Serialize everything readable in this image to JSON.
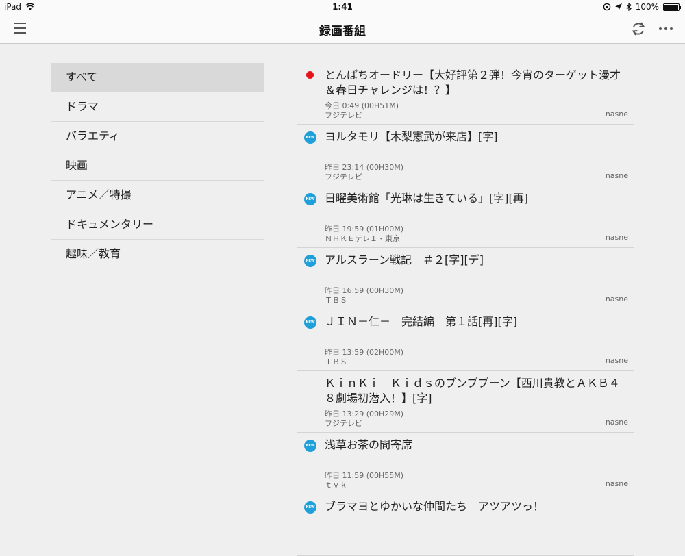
{
  "status_bar": {
    "device": "iPad",
    "time": "1:41",
    "battery": "100%"
  },
  "nav": {
    "title": "録画番組"
  },
  "sidebar": {
    "items": [
      {
        "label": "すべて",
        "selected": true
      },
      {
        "label": "ドラマ",
        "selected": false
      },
      {
        "label": "バラエティ",
        "selected": false
      },
      {
        "label": "映画",
        "selected": false
      },
      {
        "label": "アニメ／特撮",
        "selected": false
      },
      {
        "label": "ドキュメンタリー",
        "selected": false
      },
      {
        "label": "趣味／教育",
        "selected": false
      }
    ]
  },
  "recordings": [
    {
      "status": "recording",
      "title": "とんぱちオードリー【大好評第２弾！今宵のターゲット漫才＆春日チャレンジは！？】",
      "time": "今日 0:49 (00H51M)",
      "channel": "フジテレビ",
      "device": "nasne"
    },
    {
      "status": "new",
      "title": "ヨルタモリ【木梨憲武が来店】[字]",
      "time": "昨日 23:14 (00H30M)",
      "channel": "フジテレビ",
      "device": "nasne"
    },
    {
      "status": "new",
      "title": "日曜美術館「光琳は生きている」[字][再]",
      "time": "昨日 19:59 (01H00M)",
      "channel": "ＮＨＫＥテレ１・東京",
      "device": "nasne"
    },
    {
      "status": "new",
      "title": "アルスラーン戦記　＃２[字][デ]",
      "time": "昨日 16:59 (00H30M)",
      "channel": "ＴＢＳ",
      "device": "nasne"
    },
    {
      "status": "new",
      "title": "ＪＩＮ－仁－　完結編　第１話[再][字]",
      "time": "昨日 13:59 (02H00M)",
      "channel": "ＴＢＳ",
      "device": "nasne"
    },
    {
      "status": "none",
      "title": "ＫｉｎＫｉ　Ｋｉｄｓのブンブブーン【西川貴教とＡＫＢ４８劇場初潜入！】[字]",
      "time": "昨日 13:29 (00H29M)",
      "channel": "フジテレビ",
      "device": "nasne"
    },
    {
      "status": "new",
      "title": "浅草お茶の間寄席",
      "time": "昨日 11:59 (00H55M)",
      "channel": "ｔｖｋ",
      "device": "nasne"
    },
    {
      "status": "new",
      "title": "ブラマヨとゆかいな仲間たち　アツアツっ！",
      "time": "",
      "channel": "",
      "device": ""
    }
  ],
  "badges": {
    "new_label": "NEW",
    "recording_color": "#e5131a",
    "new_color": "#1fa0d9"
  }
}
